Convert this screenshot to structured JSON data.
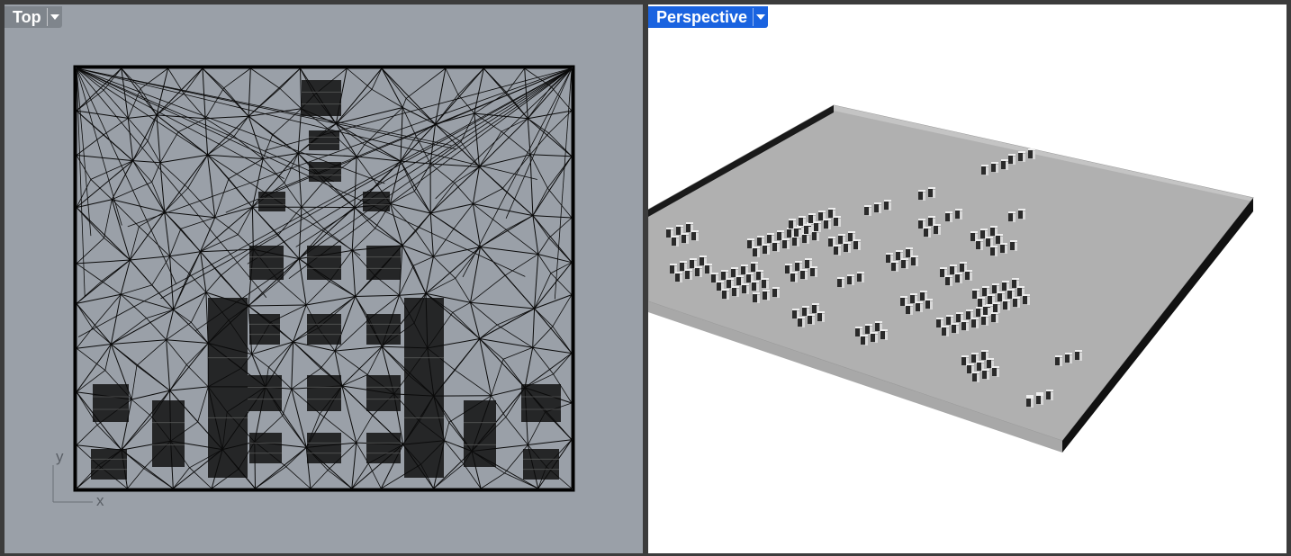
{
  "viewports": {
    "top": {
      "title": "Top",
      "background": "#9aa0a8"
    },
    "perspective": {
      "title": "Perspective",
      "background": "#ffffff",
      "active_color": "#1a63e0"
    }
  },
  "axes": {
    "x_label": "x",
    "y_label": "y"
  },
  "icons": {
    "viewport_menu": "chevron-down-icon"
  }
}
